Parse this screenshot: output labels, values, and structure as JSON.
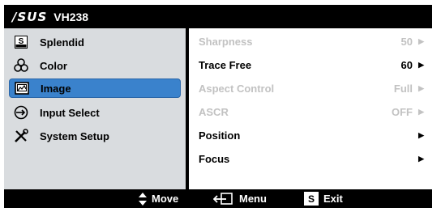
{
  "header": {
    "brand": "/SUS",
    "model": "VH238"
  },
  "sidebar": {
    "items": [
      {
        "label": "Splendid",
        "icon": "splendid-s-icon"
      },
      {
        "label": "Color",
        "icon": "color-circles-icon"
      },
      {
        "label": "Image",
        "icon": "image-icon",
        "selected": true
      },
      {
        "label": "Input Select",
        "icon": "input-arrow-icon"
      },
      {
        "label": "System Setup",
        "icon": "tools-icon"
      }
    ]
  },
  "main": {
    "rows": [
      {
        "label": "Sharpness",
        "value": "50",
        "enabled": false
      },
      {
        "label": "Trace Free",
        "value": "60",
        "enabled": true
      },
      {
        "label": "Aspect Control",
        "value": "Full",
        "enabled": false
      },
      {
        "label": "ASCR",
        "value": "OFF",
        "enabled": false
      },
      {
        "label": "Position",
        "value": "",
        "enabled": true
      },
      {
        "label": "Focus",
        "value": "",
        "enabled": true
      }
    ]
  },
  "footer": {
    "move": "Move",
    "menu": "Menu",
    "exit_key": "S",
    "exit": "Exit"
  },
  "colors": {
    "selected_bg": "#3a82cc",
    "sidebar_bg": "#d9dcdf",
    "disabled_text": "#c2c2c2"
  }
}
